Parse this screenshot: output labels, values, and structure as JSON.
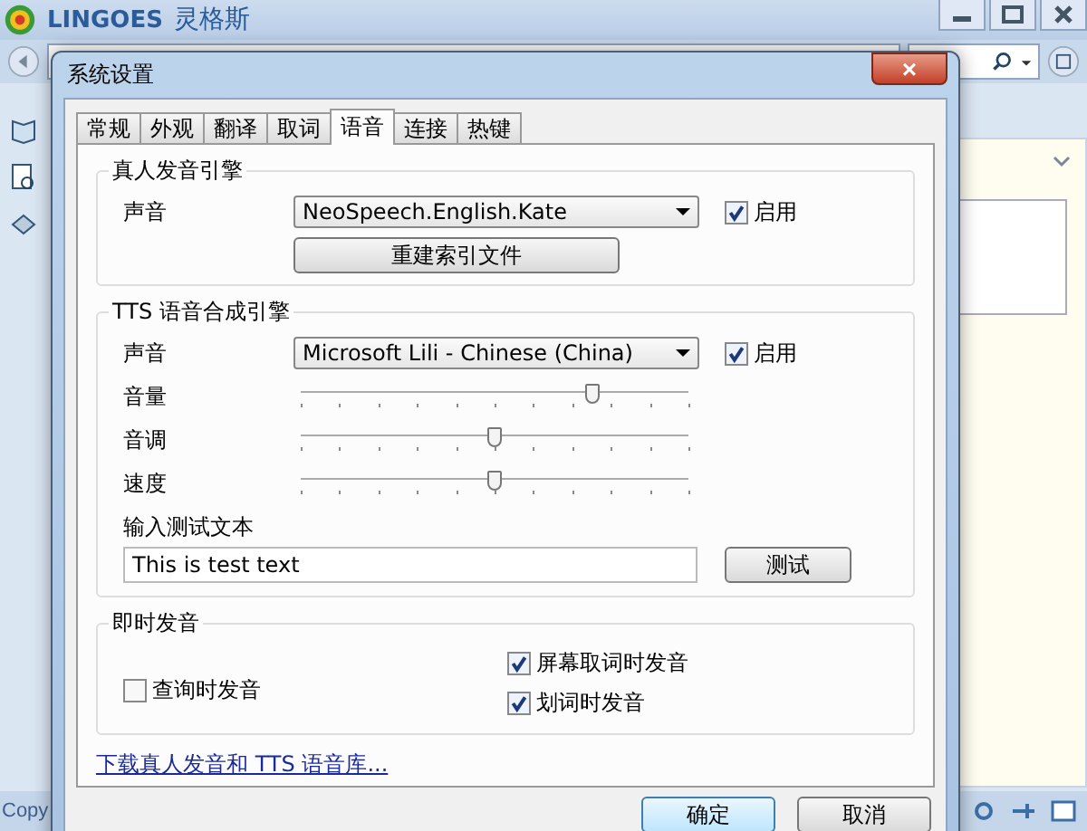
{
  "app": {
    "logo_text": "LINGOES",
    "logo_cn": "灵格斯",
    "status_text": "Copy"
  },
  "dialog": {
    "title": "系统设置",
    "close": "×",
    "tabs": [
      {
        "label": "常规",
        "selected": false
      },
      {
        "label": "外观",
        "selected": false
      },
      {
        "label": "翻译",
        "selected": false
      },
      {
        "label": "取词",
        "selected": false
      },
      {
        "label": "语音",
        "selected": true
      },
      {
        "label": "连接",
        "selected": false
      },
      {
        "label": "热键",
        "selected": false
      }
    ],
    "human_engine": {
      "title": "真人发音引擎",
      "voice_label": "声音",
      "voice": "NeoSpeech.English.Kate",
      "enable": {
        "label": "启用",
        "checked": true
      },
      "rebuild_button": "重建索引文件"
    },
    "tts_engine": {
      "title": "TTS 语音合成引擎",
      "voice_label": "声音",
      "voice": "Microsoft Lili - Chinese (China)",
      "enable": {
        "label": "启用",
        "checked": true
      },
      "sliders": [
        {
          "label": "音量",
          "level": 0.75
        },
        {
          "label": "音调",
          "level": 0.5
        },
        {
          "label": "速度",
          "level": 0.5
        }
      ],
      "test_label": "输入测试文本",
      "test_text": "This is test text",
      "test_button": "测试"
    },
    "instant": {
      "title": "即时发音",
      "options": [
        {
          "label": "查询时发音",
          "checked": false
        },
        {
          "label": "屏幕取词时发音",
          "checked": true
        },
        {
          "label": "划词时发音",
          "checked": true
        }
      ]
    },
    "download_link": "下载真人发音和 TTS 语音库...",
    "buttons": [
      {
        "label": "确定",
        "kind": "default"
      },
      {
        "label": "取消",
        "kind": "normal"
      }
    ]
  }
}
